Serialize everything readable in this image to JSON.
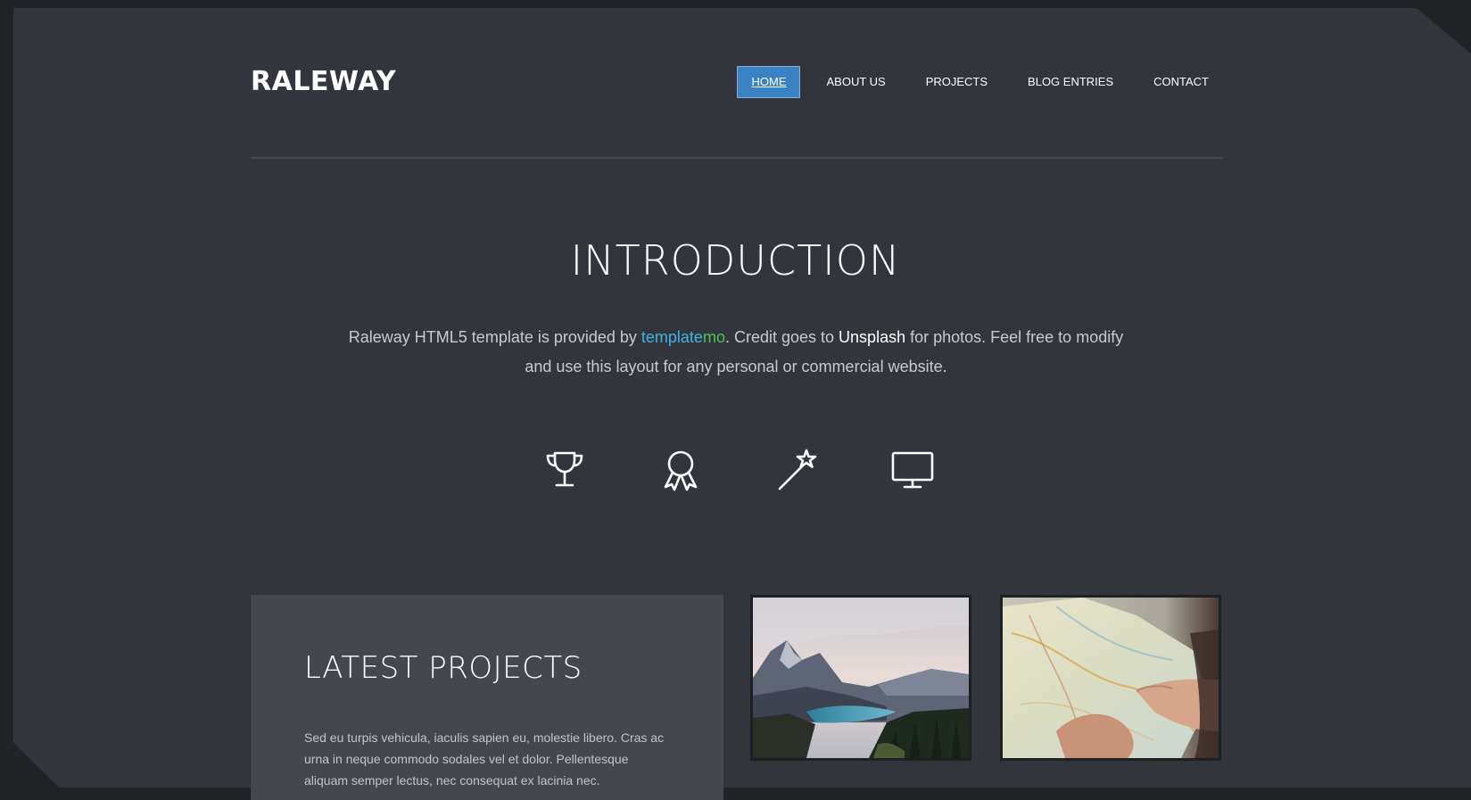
{
  "header": {
    "logo": "RALEWAY",
    "nav": [
      "HOME",
      "ABOUT US",
      "PROJECTS",
      "BLOG ENTRIES",
      "CONTACT"
    ],
    "active_nav": "HOME"
  },
  "intro": {
    "title": "INTRODUCTION",
    "text_1": "Raleway HTML5 template is provided by ",
    "brand_part1": "template",
    "brand_part2": "mo",
    "text_2": ". Credit goes to ",
    "unsplash": "Unsplash",
    "text_3": " for photos. Feel free to modify and use this layout for any personal or commercial website."
  },
  "icons": [
    "trophy-icon",
    "award-ribbon-icon",
    "magic-wand-icon",
    "desktop-monitor-icon"
  ],
  "projects": {
    "title": "LATEST PROJECTS",
    "text": "Sed eu turpis vehicula, iaculis sapien eu, molestie libero. Cras ac urna in neque commodo sodales vel et dolor. Pellentesque aliquam semper lectus, nec consequat ex lacinia nec."
  },
  "colors": {
    "background": "#32353b",
    "outer": "#212326",
    "accent": "#3a82c4",
    "panel": "#44474e",
    "templatemo_blue": "#3fb4e4",
    "templatemo_green": "#4cc452"
  },
  "thumbnails": [
    "mountain-lake-photo",
    "map-in-hands-photo"
  ]
}
